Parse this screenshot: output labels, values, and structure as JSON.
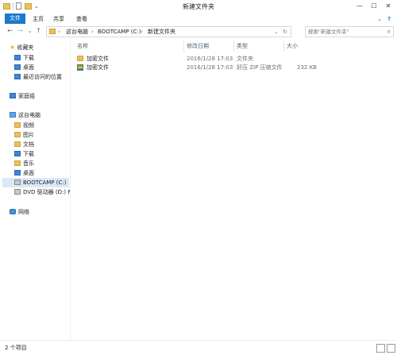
{
  "window": {
    "title": "新建文件夹",
    "minimize": "—",
    "maximize": "☐",
    "close": "✕"
  },
  "ribbon": {
    "tabs": [
      "文件",
      "主页",
      "共享",
      "查看"
    ],
    "expand": "⌄",
    "help": "?"
  },
  "nav": {
    "back": "←",
    "forward": "→",
    "recent": "⌄",
    "up": "↑",
    "breadcrumb": [
      "这台电脑",
      "BOOTCAMP (C:)",
      "新建文件夹"
    ],
    "crumb_sep": "›",
    "refresh": "↻",
    "search_placeholder": "搜索\"新建文件夹\"",
    "search_icon": "⌕"
  },
  "sidebar": {
    "favorites": {
      "label": "收藏夹",
      "items": [
        "下载",
        "桌面",
        "最近访问的位置"
      ]
    },
    "homegroup": "家庭组",
    "thispc": {
      "label": "这台电脑",
      "items": [
        "视频",
        "图片",
        "文档",
        "下载",
        "音乐",
        "桌面",
        "BOOTCAMP (C:)",
        "DVD 驱动器 (D:) NI"
      ]
    },
    "network": "网络"
  },
  "columns": {
    "name": "名称",
    "modified": "修改日期",
    "type": "类型",
    "size": "大小"
  },
  "files": [
    {
      "name": "加密文件",
      "modified": "2016/1/28 17:03",
      "type": "文件夹",
      "size": "",
      "icon": "folder-icon"
    },
    {
      "name": "加密文件",
      "modified": "2016/1/28 17:03",
      "type": "好压 ZIP 压缩文件",
      "size": "232 KB",
      "icon": "zip-archive-icon"
    }
  ],
  "status": {
    "item_count": "2 个项目"
  },
  "colors": {
    "file_tab": "#1979ca",
    "selected_nav": "#dbe9f7",
    "folder": "#e8c25a"
  }
}
